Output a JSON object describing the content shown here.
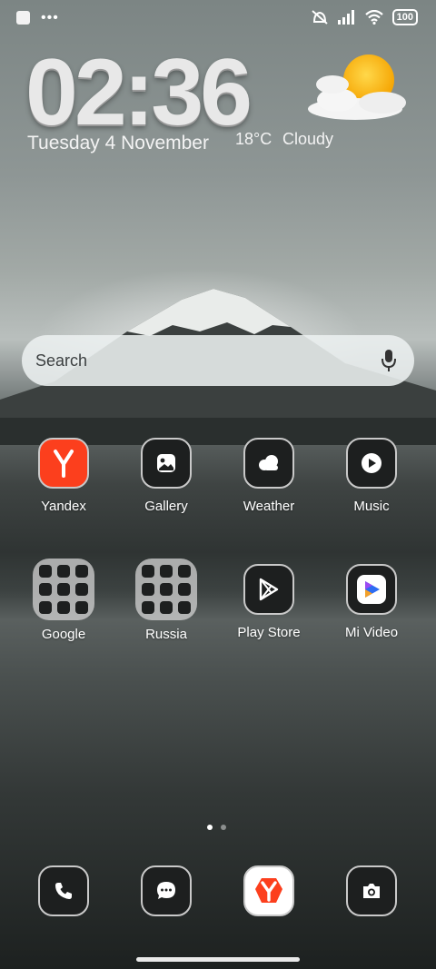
{
  "status_bar": {
    "left_icons": [
      "square-notification-icon",
      "more-dots-icon"
    ],
    "right_icons": [
      "vibrate-off-icon",
      "signal-icon",
      "wifi-icon",
      "battery-icon"
    ],
    "battery_level": "100"
  },
  "clock": {
    "time": "02:36",
    "date": "Tuesday 4 November"
  },
  "weather": {
    "temperature": "18°C",
    "condition": "Cloudy",
    "icon": "partly-cloudy-sun-icon"
  },
  "search": {
    "placeholder": "Search",
    "mic_icon": "microphone-icon"
  },
  "apps": [
    {
      "label": "Yandex",
      "icon": "yandex-icon"
    },
    {
      "label": "Gallery",
      "icon": "gallery-icon"
    },
    {
      "label": "Weather",
      "icon": "weather-cloud-icon"
    },
    {
      "label": "Music",
      "icon": "music-play-icon"
    },
    {
      "label": "Google",
      "icon": "folder-icon"
    },
    {
      "label": "Russia",
      "icon": "folder-icon"
    },
    {
      "label": "Play Store",
      "icon": "play-store-icon"
    },
    {
      "label": "Mi Video",
      "icon": "mi-video-icon"
    }
  ],
  "page_indicator": {
    "pages": 2,
    "current": 1
  },
  "dock": [
    {
      "icon": "phone-icon"
    },
    {
      "icon": "messages-icon"
    },
    {
      "icon": "yandex-browser-icon"
    },
    {
      "icon": "camera-icon"
    }
  ],
  "colors": {
    "yandex_red": "#fc3f1d",
    "tile_bg": "#1d1f1f",
    "tile_border": "#c9c9c9"
  }
}
